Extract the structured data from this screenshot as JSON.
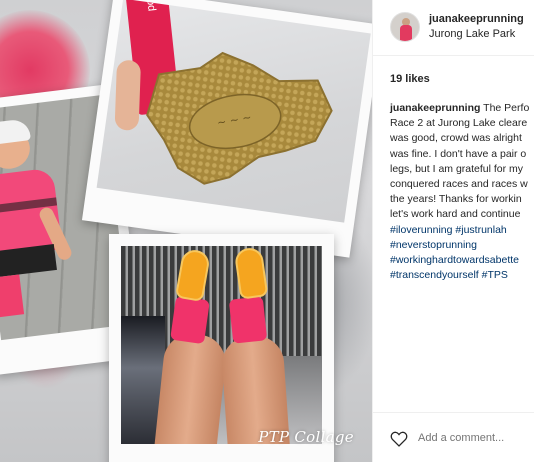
{
  "post": {
    "username": "juanakeeprunning",
    "location": "Jurong Lake Park",
    "likes": "19 likes",
    "caption_lines": [
      "The Perfo",
      "Race 2 at Jurong Lake cleare",
      "was good, crowd was alright",
      "was fine. I don't have a pair o",
      "legs, but I am grateful for my",
      "conquered races and races w",
      "the years! Thanks for workin",
      "let's work hard and continue"
    ],
    "hashtags": [
      [
        "#iloverunning",
        "#justrunlah"
      ],
      [
        "#neverstoprunning"
      ],
      [
        "#workinghardtowardsabette"
      ],
      [
        "#transcendyourself",
        "#TPS"
      ]
    ],
    "add_comment_placeholder": "Add a comment..."
  },
  "media": {
    "watermark": "PTP Collage",
    "ribbon_text": "powe",
    "photos": [
      "runner-photo",
      "medal-photo",
      "shoes-photo"
    ]
  },
  "colors": {
    "hashtag": "#003569",
    "text": "#262626",
    "muted": "#999999",
    "accent_pink": "#f0336a",
    "medal_gold": "#a8893c"
  },
  "icons": {
    "like": "heart-outline-icon"
  }
}
